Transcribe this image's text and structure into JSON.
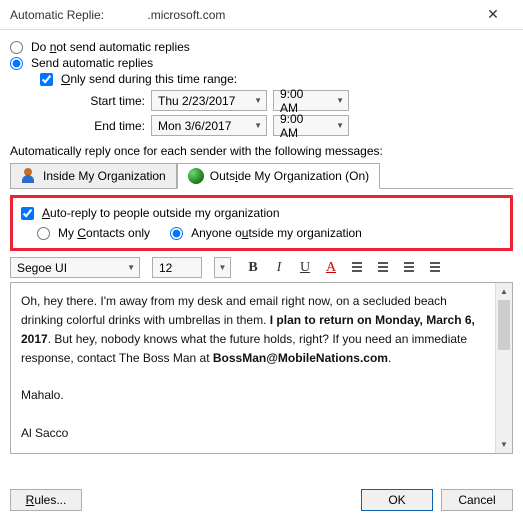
{
  "window": {
    "title_left": "Automatic Replie:",
    "title_right": ".microsoft.com"
  },
  "mode": {
    "do_not_send": "Do not send automatic replies",
    "send": "Send automatic replies"
  },
  "range": {
    "only_send": "Only send during this time range:",
    "start_label": "Start time:",
    "end_label": "End time:",
    "start_date": "Thu 2/23/2017",
    "start_time": "9:00 AM",
    "end_date": "Mon 3/6/2017",
    "end_time": "9:00 AM"
  },
  "section_msg": "Automatically reply once for each sender with the following messages:",
  "tabs": {
    "inside": "Inside My Organization",
    "outside": "Outside My Organization (On)"
  },
  "outside_opts": {
    "autoreply": "Auto-reply to people outside my organization",
    "contacts_only": "My Contacts only",
    "anyone": "Anyone outside my organization"
  },
  "toolbar": {
    "font": "Segoe UI",
    "size": "12"
  },
  "message": {
    "p1a": "Oh, hey there. I'm away from my desk and email right now, on a secluded beach drinking colorful drinks with umbrellas in them. ",
    "p1b": "I plan to return on Monday, March 6, 2017",
    "p1c": ". But hey, nobody knows what the future holds, right? If you need an immediate response, contact The Boss Man at ",
    "p1d": "BossMan@MobileNations.com",
    "p1e": ".",
    "p2": "Mahalo.",
    "p3": "Al Sacco"
  },
  "buttons": {
    "rules": "Rules...",
    "ok": "OK",
    "cancel": "Cancel"
  }
}
